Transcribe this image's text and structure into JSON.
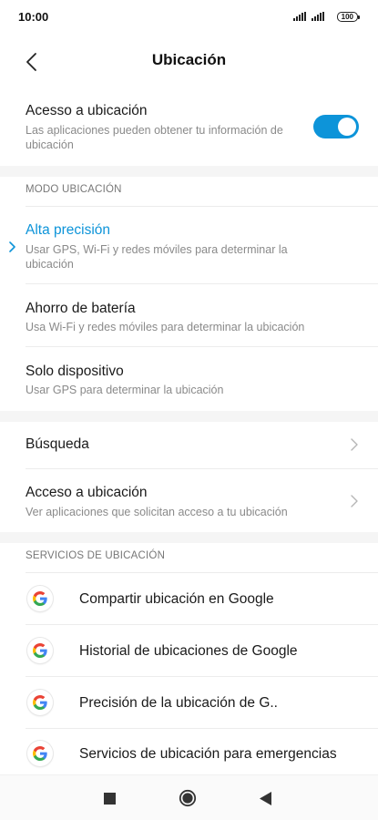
{
  "status_bar": {
    "time": "10:00",
    "battery": "100"
  },
  "header": {
    "title": "Ubicación"
  },
  "location_access": {
    "title": "Acesso a ubicación",
    "subtitle": "Las aplicaciones pueden obtener tu información de ubicación",
    "enabled": true
  },
  "mode_section": {
    "header": "MODO UBICACIÓN",
    "items": [
      {
        "title": "Alta precisión",
        "subtitle": "Usar GPS, Wi-Fi y redes móviles para determinar la ubicación",
        "selected": true
      },
      {
        "title": "Ahorro de batería",
        "subtitle": "Usa Wi-Fi y redes móviles para determinar la ubicación",
        "selected": false
      },
      {
        "title": "Solo dispositivo",
        "subtitle": "Usar GPS para determinar la ubicación",
        "selected": false
      }
    ]
  },
  "more": {
    "search": {
      "title": "Búsqueda"
    },
    "access": {
      "title": "Acceso a ubicación",
      "subtitle": "Ver aplicaciones que solicitan acceso a tu ubicación"
    }
  },
  "services_section": {
    "header": "SERVICIOS DE UBICACIÓN",
    "items": [
      {
        "label": "Compartir ubicación en Google",
        "icon": "google-icon"
      },
      {
        "label": "Historial de ubicaciones de Google",
        "icon": "google-icon"
      },
      {
        "label": "Precisión de la ubicación de G..",
        "icon": "google-icon"
      },
      {
        "label": "Servicios de ubicación para emergencias",
        "icon": "google-icon"
      }
    ]
  },
  "colors": {
    "accent": "#0d94d9",
    "band": "#f5f5f5",
    "secondary_text": "#8a8a8a"
  },
  "nav_bar": {
    "icons": [
      "recents-square-icon",
      "home-circle-icon",
      "back-triangle-icon"
    ]
  }
}
